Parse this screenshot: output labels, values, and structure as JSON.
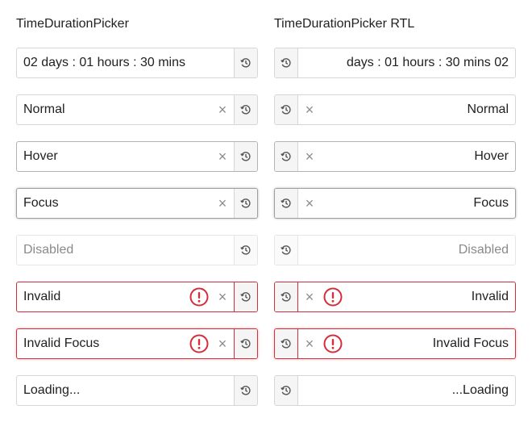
{
  "ltr": {
    "heading": "TimeDurationPicker",
    "fields": {
      "default": "02 days : 01 hours : 30 mins",
      "normal": "Normal",
      "hover": "Hover",
      "focus": "Focus",
      "disabled": "Disabled",
      "invalid": "Invalid",
      "invalid_focus": "Invalid Focus",
      "loading": "Loading..."
    }
  },
  "rtl": {
    "heading": "TimeDurationPicker RTL",
    "fields": {
      "default": "days : 01 hours : 30 mins 02",
      "normal": "Normal",
      "hover": "Hover",
      "focus": "Focus",
      "disabled": "Disabled",
      "invalid": "Invalid",
      "invalid_focus": "Invalid Focus",
      "loading": "...Loading"
    }
  },
  "icons": {
    "clear": "×",
    "picker": "history-icon",
    "error": "error-circle-icon"
  },
  "colors": {
    "border": "#d6d6d6",
    "error": "#d32f3a",
    "button_bg": "#f5f5f5"
  }
}
